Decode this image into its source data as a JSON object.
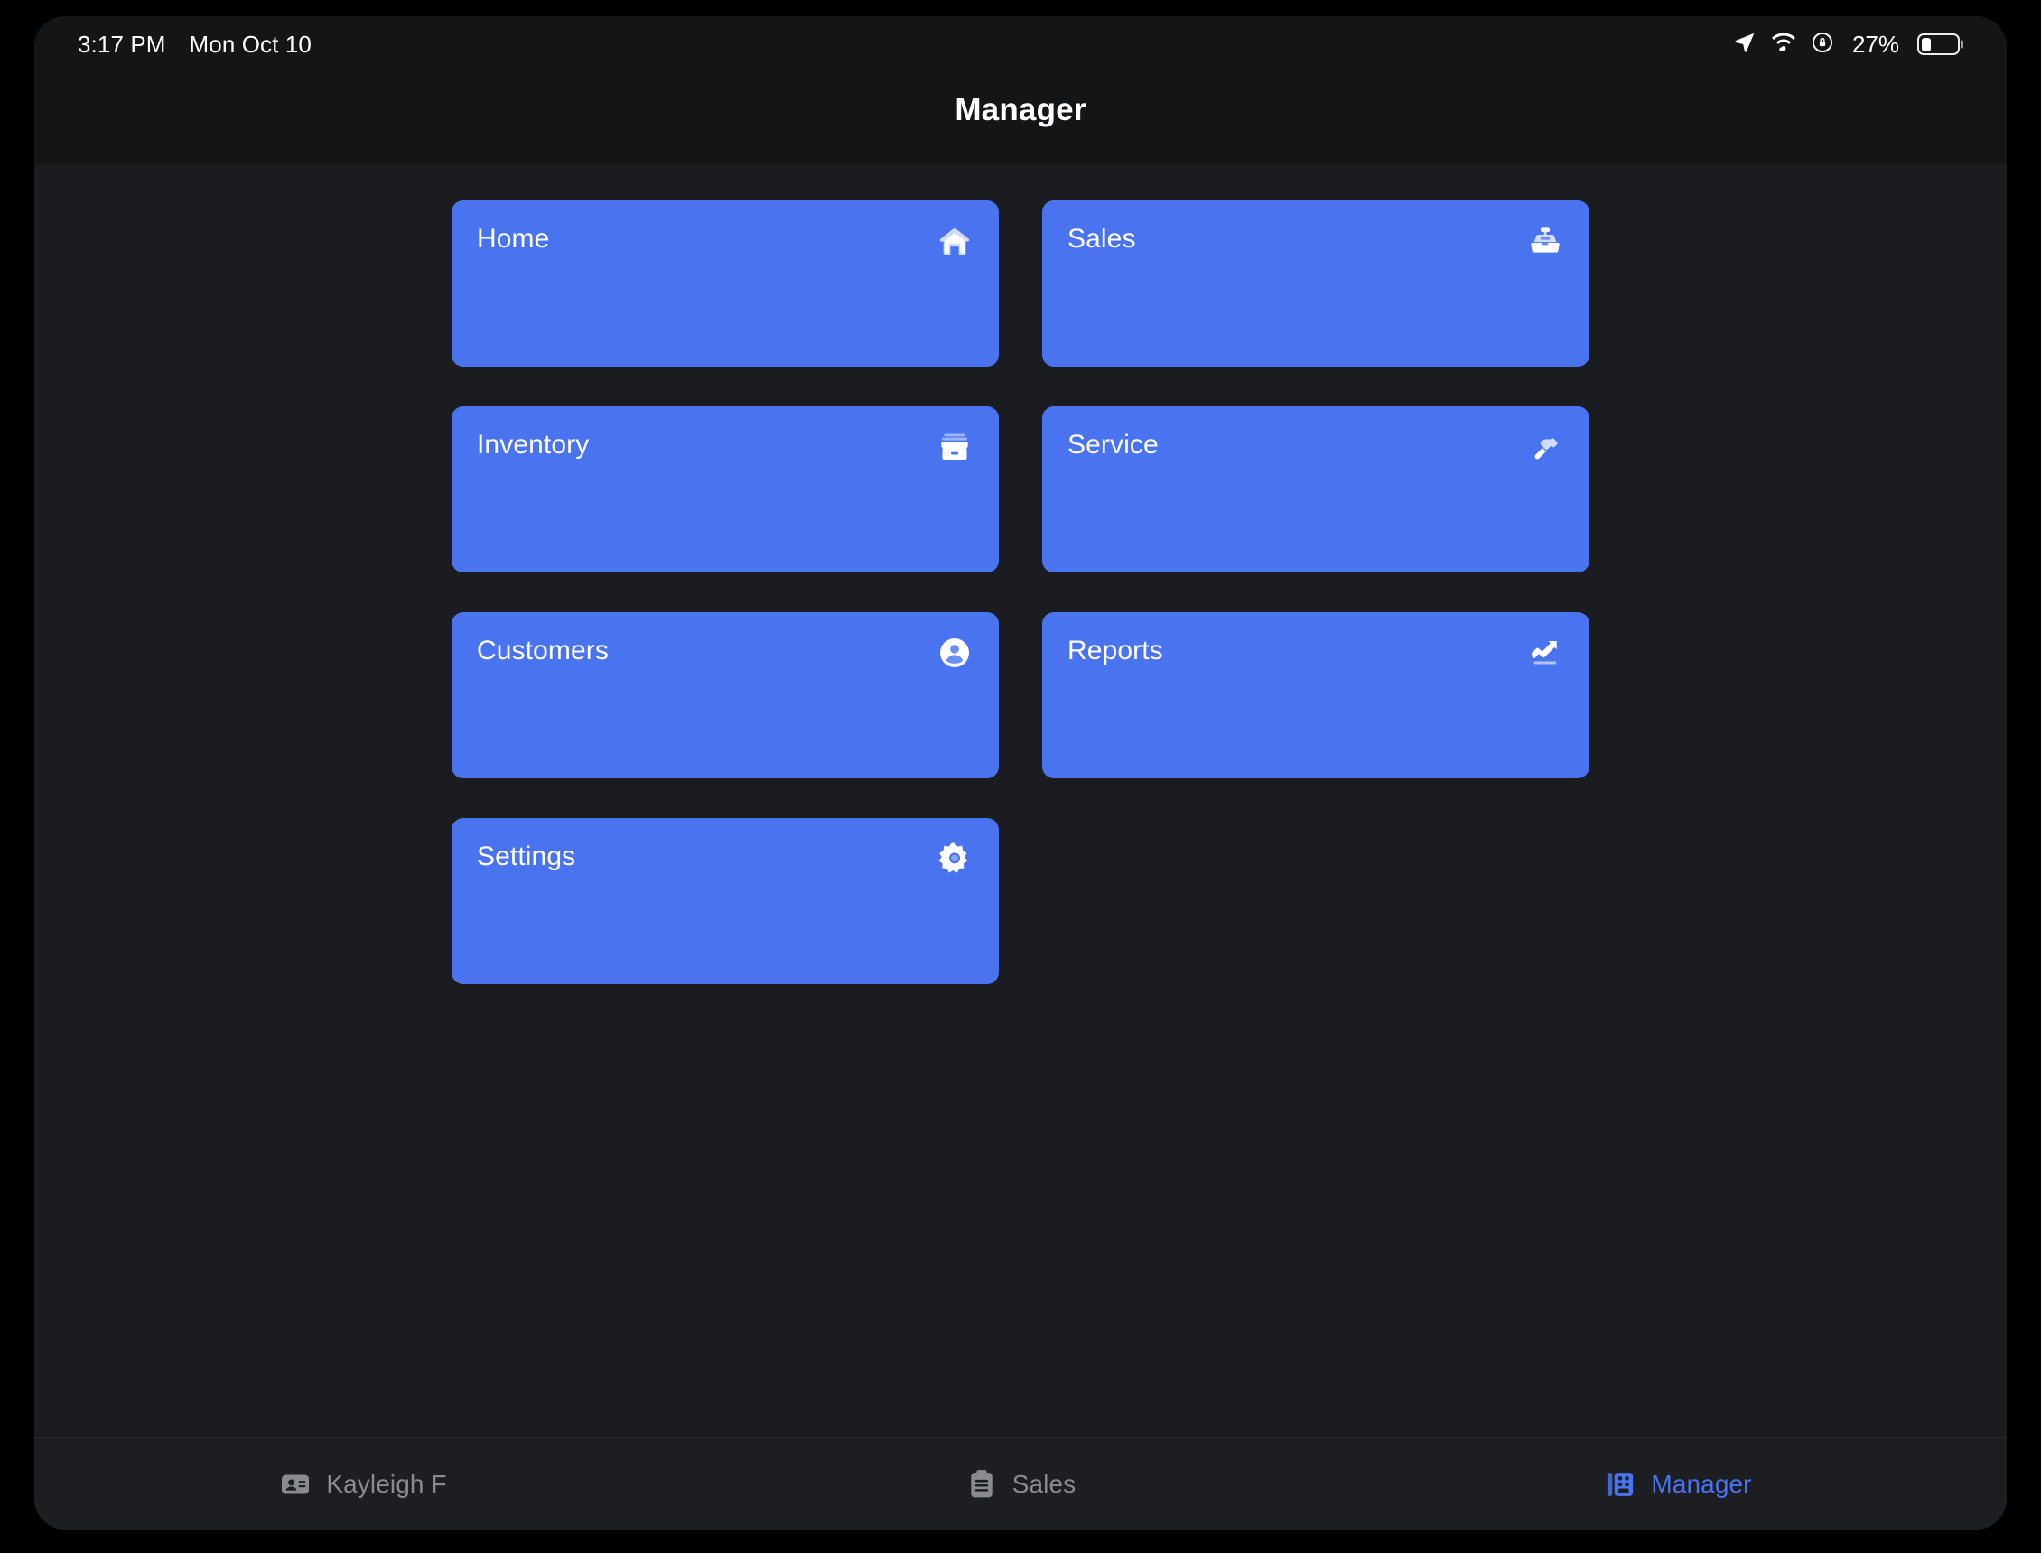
{
  "status_bar": {
    "time": "3:17 PM",
    "date": "Mon Oct 10",
    "battery_percent": "27%",
    "battery_level": 27,
    "icons": [
      "location-arrow-icon",
      "wifi-icon",
      "rotation-lock-icon",
      "battery-icon"
    ]
  },
  "header": {
    "title": "Manager"
  },
  "colors": {
    "accent": "#4a73f0",
    "card_bg": "#4a73f0",
    "card_text": "#ffffff",
    "page_bg": "#1b1c20",
    "header_bg": "#141516",
    "tabbar_bg": "#1d1e22",
    "tab_inactive": "#8a8a8f",
    "tab_active": "#4a73f0"
  },
  "main": {
    "cards": [
      {
        "label": "Home",
        "icon": "house-icon"
      },
      {
        "label": "Sales",
        "icon": "cash-register-icon"
      },
      {
        "label": "Inventory",
        "icon": "archivebox-icon"
      },
      {
        "label": "Service",
        "icon": "hammer-icon"
      },
      {
        "label": "Customers",
        "icon": "person-circle-icon"
      },
      {
        "label": "Reports",
        "icon": "chart-uptrend-icon"
      },
      {
        "label": "Settings",
        "icon": "gear-icon"
      }
    ]
  },
  "tab_bar": {
    "tabs": [
      {
        "label": "Kayleigh F",
        "icon": "person-id-card-icon",
        "active": false
      },
      {
        "label": "Sales",
        "icon": "clipboard-icon",
        "active": false
      },
      {
        "label": "Manager",
        "icon": "building-icon",
        "active": true
      }
    ]
  }
}
